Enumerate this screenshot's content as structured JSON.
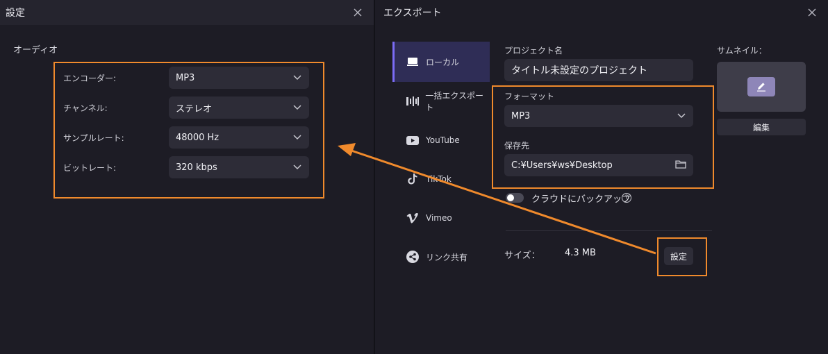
{
  "left_panel": {
    "title": "設定",
    "section": "オーディオ",
    "rows": [
      {
        "label": "エンコーダー:",
        "value": "MP3"
      },
      {
        "label": "チャンネル:",
        "value": "ステレオ"
      },
      {
        "label": "サンプルレート:",
        "value": "48000 Hz"
      },
      {
        "label": "ビットレート:",
        "value": "320 kbps"
      }
    ]
  },
  "right_panel": {
    "title": "エクスポート",
    "nav": [
      {
        "label": "ローカル",
        "icon": "local-device-icon",
        "active": true
      },
      {
        "label": "一括エクスポート",
        "icon": "batch-export-icon"
      },
      {
        "label": "YouTube",
        "icon": "youtube-icon"
      },
      {
        "label": "TikTok",
        "icon": "tiktok-icon"
      },
      {
        "label": "Vimeo",
        "icon": "vimeo-icon"
      },
      {
        "label": "リンク共有",
        "icon": "share-icon"
      }
    ],
    "project_name_label": "プロジェクト名",
    "project_name_value": "タイトル未設定のプロジェクト",
    "format_label": "フォーマット",
    "format_value": "MP3",
    "save_to_label": "保存先",
    "save_to_value": "C:¥Users¥ws¥Desktop",
    "cloud_backup_label": "クラウドにバックアップ",
    "help_glyph": "?",
    "size_label": "サイズ：",
    "size_value": "4.3 MB",
    "settings_button": "設定",
    "thumbnail_label": "サムネイル：",
    "edit_button": "編集"
  },
  "colors": {
    "highlight": "#f08a2c",
    "accent": "#7b6cf6",
    "background": "#1d1c25"
  }
}
